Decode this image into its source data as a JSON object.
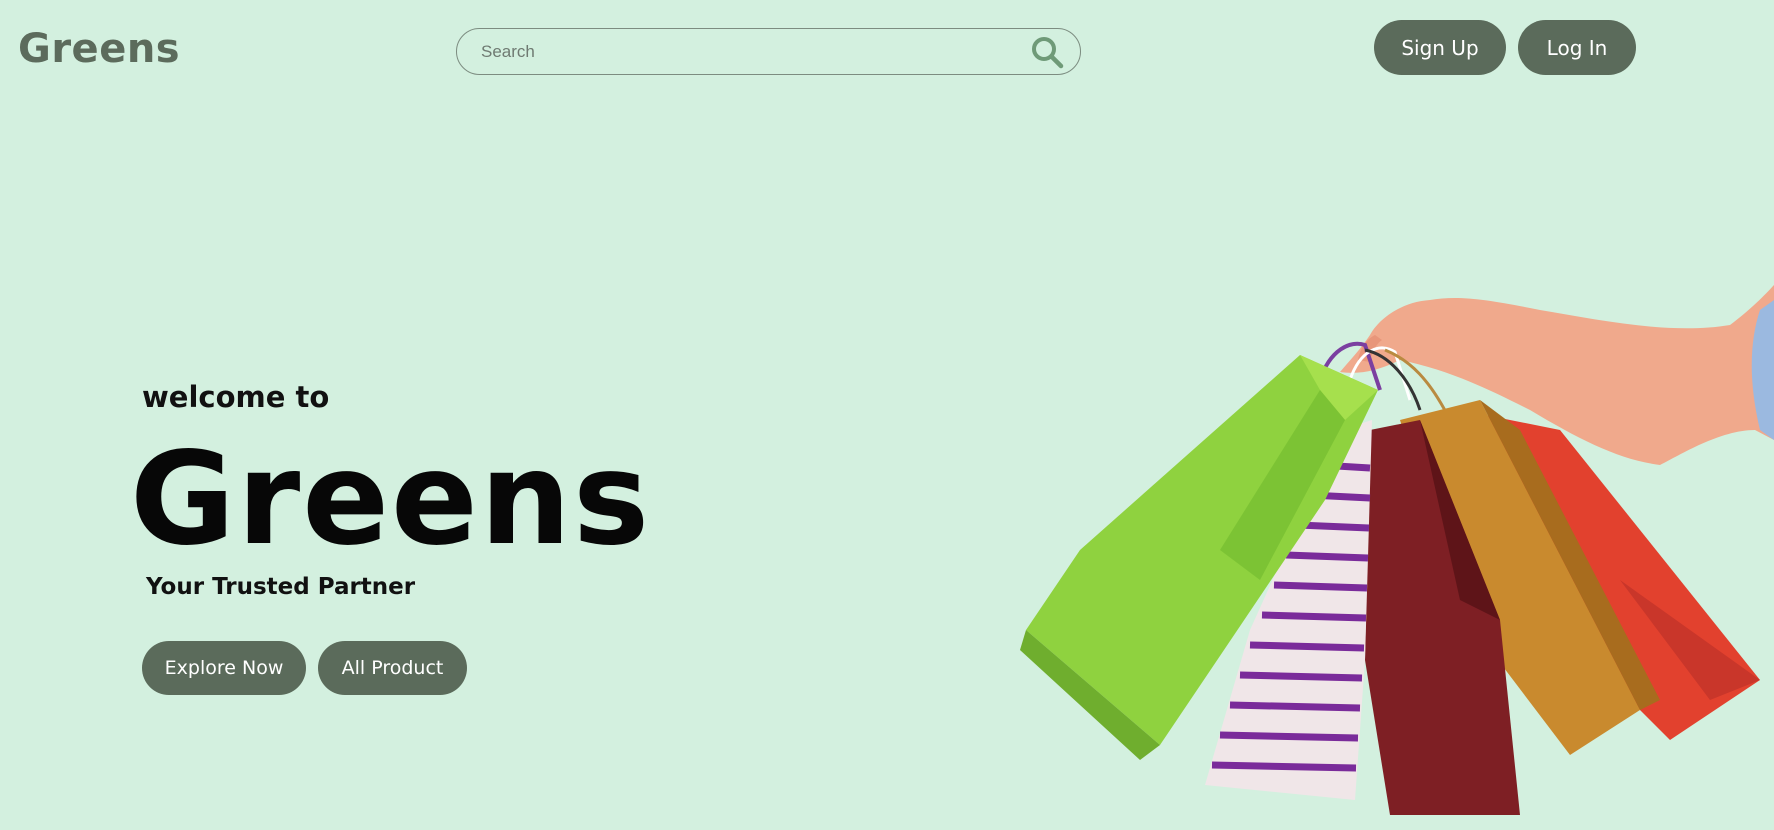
{
  "header": {
    "logo": "Greens",
    "search_placeholder": "Search",
    "signup_label": "Sign Up",
    "login_label": "Log In"
  },
  "hero": {
    "welcome": "welcome to",
    "title": "Greens",
    "tagline": "Your Trusted Partner",
    "explore_label": "Explore Now",
    "all_product_label": "All Product"
  },
  "icons": {
    "search": "search-icon"
  },
  "colors": {
    "background": "#d3f0df",
    "button": "#5b6b5b",
    "logo": "#5c6b5c",
    "search_icon": "#6f9a78"
  }
}
